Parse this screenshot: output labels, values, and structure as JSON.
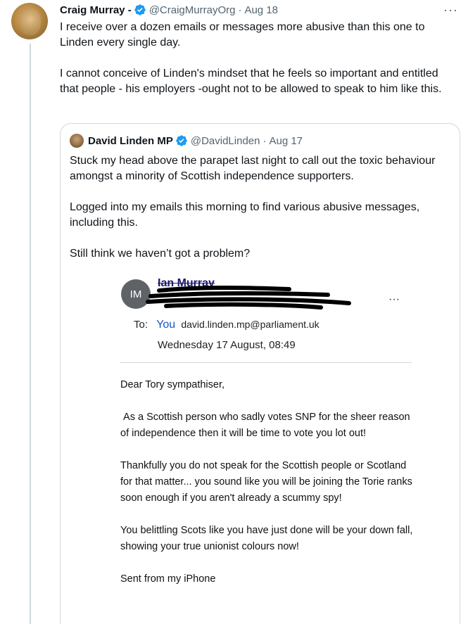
{
  "tweet": {
    "author_name": "Craig Murray -",
    "handle": "@CraigMurrayOrg",
    "separator": "·",
    "date": "Aug 18",
    "more_icon": "more-horizontal-icon",
    "paragraphs": [
      "I receive over a dozen emails or messages more abusive than this one to Linden every single day.",
      "I cannot conceive of Linden's mindset that he feels so important and entitled that people - his employers -ought not to be allowed to speak to him like this."
    ]
  },
  "quote": {
    "author_name": "David Linden MP",
    "handle": "@DavidLinden",
    "separator": "·",
    "date": "Aug 17",
    "paragraphs": [
      "Stuck my head above the parapet last night to call out the toxic behaviour amongst a minority of Scottish independence supporters.",
      "Logged into my emails this morning to find various abusive messages, including this.",
      "Still think we haven’t got a problem?"
    ]
  },
  "email": {
    "avatar_initials": "IM",
    "sender_name": "Ian Murray",
    "more": "···",
    "to_label": "To:",
    "to_you": "You",
    "to_address": "david.linden.mp@parliament.uk",
    "date": "Wednesday 17 August, 08:49",
    "body": [
      "Dear Tory sympathiser,",
      " As a Scottish person who sadly votes SNP for the sheer reason of independence then it will be time to vote you lot out!",
      "Thankfully you do not speak for the Scottish people or Scotland for that matter... you sound like you will be joining the Torie ranks soon enough if you aren't already a scummy spy!",
      "You belittling Scots like you have just done will be your down fall, showing your true unionist colours now!",
      "Sent from my iPhone"
    ]
  },
  "colors": {
    "verified": "#1d9bf0",
    "secondary_text": "#536471",
    "border": "#cfd9de"
  }
}
